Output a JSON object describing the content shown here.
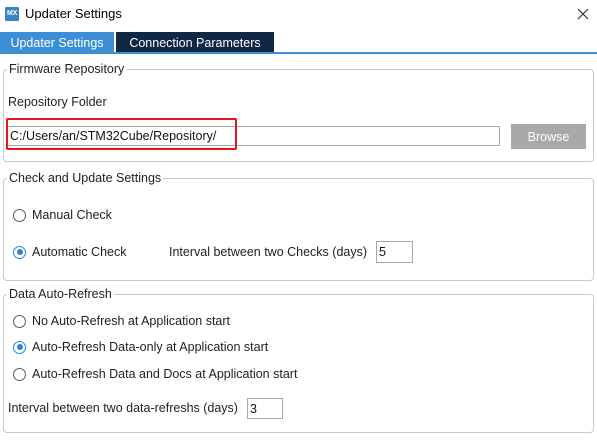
{
  "window": {
    "icon_text": "MX",
    "title": "Updater Settings"
  },
  "tabs": [
    {
      "label": "Updater Settings",
      "active": true
    },
    {
      "label": "Connection Parameters",
      "active": false
    }
  ],
  "firmware_repository": {
    "legend": "Firmware Repository",
    "folder_label": "Repository Folder",
    "folder_value": "C:/Users/an/STM32Cube/Repository/",
    "browse_label": "Browse",
    "highlight_color": "#e8141b"
  },
  "check_update": {
    "legend": "Check and Update Settings",
    "options": [
      {
        "label": "Manual Check",
        "checked": false
      },
      {
        "label": "Automatic Check",
        "checked": true
      }
    ],
    "interval_label": "Interval between two Checks (days)",
    "interval_value": "5"
  },
  "data_refresh": {
    "legend": "Data Auto-Refresh",
    "options": [
      {
        "label": "No Auto-Refresh at Application start",
        "checked": false
      },
      {
        "label": "Auto-Refresh Data-only at Application start",
        "checked": true
      },
      {
        "label": "Auto-Refresh Data and Docs at Application start",
        "checked": false
      }
    ],
    "interval_label": "Interval between two data-refreshs (days)",
    "interval_value": "3"
  },
  "colors": {
    "tab_active": "#3c8fd4",
    "tab_inactive": "#0f2743",
    "radio_checked": "#2b86d6",
    "browse_button": "#a9a9a9"
  },
  "icons": {
    "app": "mx-app-icon",
    "close": "close-icon"
  }
}
